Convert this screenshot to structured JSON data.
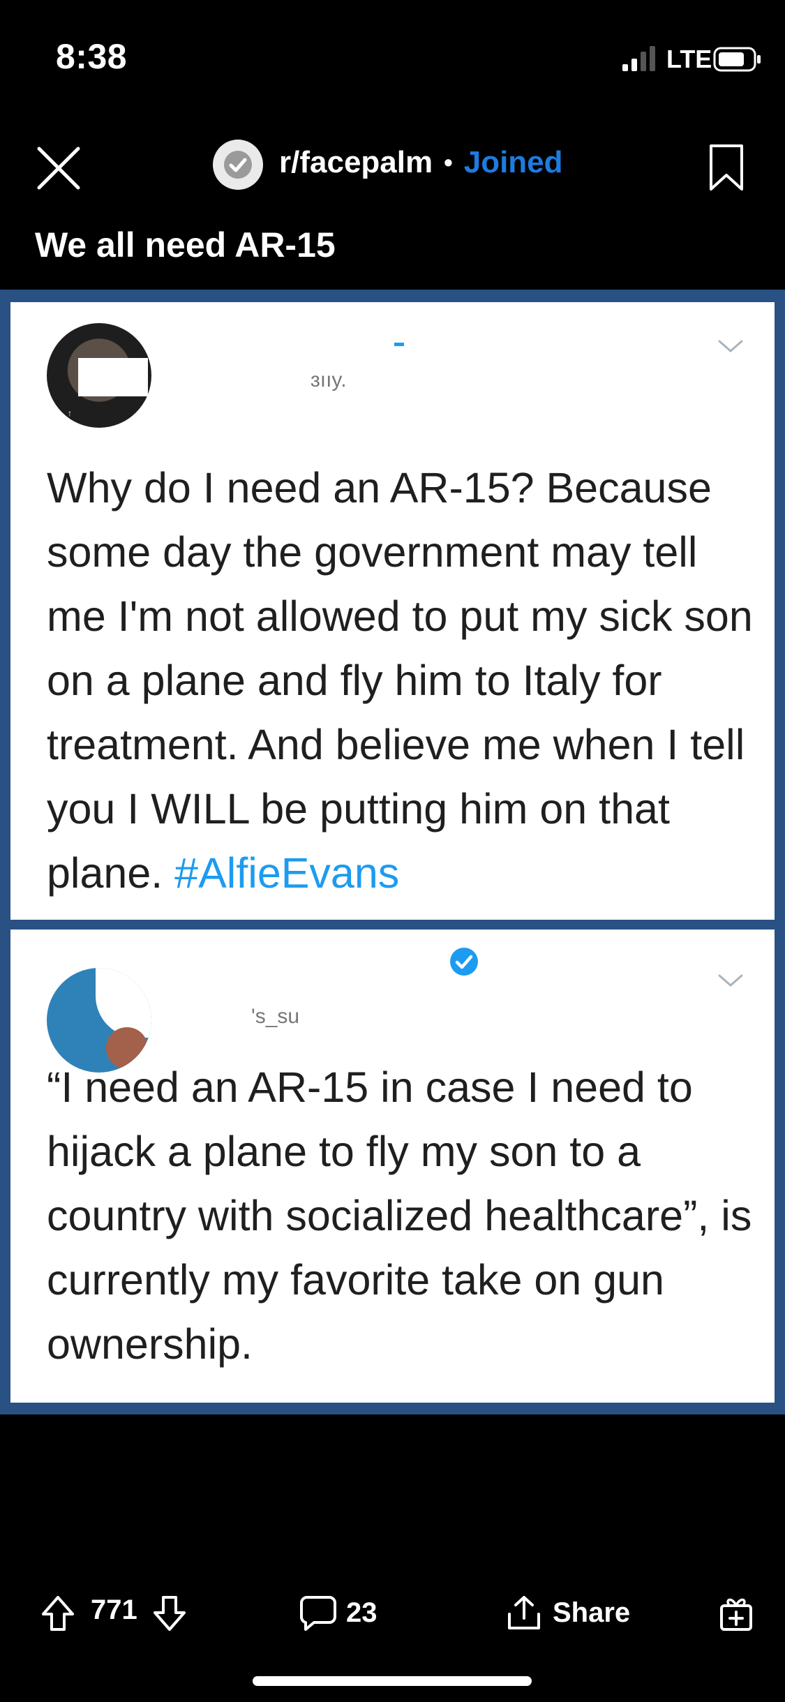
{
  "status_bar": {
    "time": "8:38",
    "network": "LTE"
  },
  "header": {
    "subreddit": "r/facepalm",
    "separator": "•",
    "membership": "Joined",
    "title": "We all need AR-15"
  },
  "tweets": [
    {
      "handle": "ɜııy.",
      "text_before_hashtag": "Why do I need an AR-15? Because some day the government may tell me I'm not allowed to put my sick son on a plane and fly him to Italy for treatment. And believe me when I tell you I WILL be putting him on that plane. ",
      "hashtag": "#AlfieEvans"
    },
    {
      "handle": "'s_su",
      "verified": true,
      "text": "“I need an AR-15 in case I need to hijack a plane to fly my son to a country with socialized healthcare”, is currently my favorite take on gun ownership."
    }
  ],
  "actions": {
    "vote_count": "771",
    "comment_count": "23",
    "share_label": "Share"
  },
  "colors": {
    "joined": "#1e7be0",
    "hashtag": "#1d9bf0",
    "image_frame": "#295183"
  },
  "icons": [
    "close-icon",
    "subreddit-icon",
    "bookmark-icon",
    "verified-icon",
    "chevron-down-icon",
    "upvote-icon",
    "downvote-icon",
    "comment-icon",
    "share-icon",
    "award-icon"
  ]
}
